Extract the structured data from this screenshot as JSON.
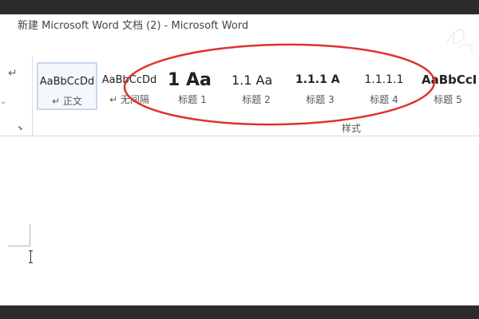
{
  "window": {
    "title": "新建 Microsoft Word 文档 (2) - Microsoft Word"
  },
  "ribbon": {
    "paragraph": {
      "mark_icon": "paragraph-return-icon",
      "launcher_icon": "dialog-launcher-icon"
    },
    "styles": {
      "group_label": "样式",
      "items": [
        {
          "sample": "AaBbCcDd",
          "label": "↵ 正文",
          "selected": true
        },
        {
          "sample": "AaBbCcDd",
          "label": "↵ 无间隔",
          "selected": false
        },
        {
          "sample": "1  Aa",
          "label": "标题 1",
          "selected": false
        },
        {
          "sample": "1.1  Aa",
          "label": "标题 2",
          "selected": false
        },
        {
          "sample": "1.1.1  A",
          "label": "标题 3",
          "selected": false
        },
        {
          "sample": "1.1.1.1",
          "label": "标题 4",
          "selected": false
        },
        {
          "sample": "AaBbCcI",
          "label": "标题 5",
          "selected": false
        }
      ]
    }
  },
  "annotation": {
    "color": "#e03131"
  },
  "colors": {
    "chrome_dark": "#2b2b2b",
    "selected_border": "#c5d8ee"
  }
}
